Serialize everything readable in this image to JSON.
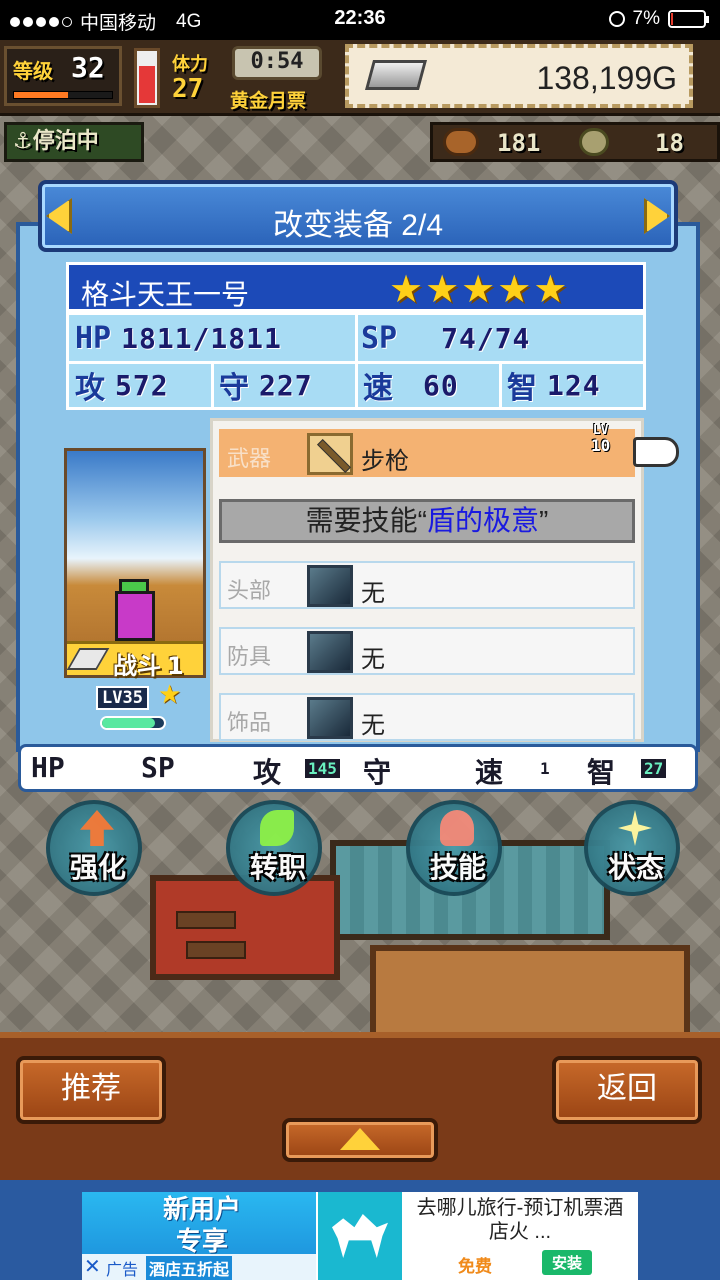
{
  "status_bar": {
    "carrier": "中国移动",
    "network": "4G",
    "time": "22:36",
    "battery": "7%",
    "battery_level": 0.07,
    "signal_dots_filled": 4,
    "signal_dots_total": 5
  },
  "hud": {
    "level_label": "等级",
    "level_value": "32",
    "level_progress": 0.55,
    "stamina_label": "体力",
    "stamina_value": "27",
    "stamina_level": 0.75,
    "timer": "0:54",
    "ticket_label": "黄金月票",
    "gold_value": "138,199G",
    "docked_label": "停泊中",
    "resource_1": "181",
    "resource_2": "18"
  },
  "dialog": {
    "title": "改变装备 2/4",
    "character_name": "格斗天王一号",
    "star_count": 5,
    "stats": {
      "hp_label": "HP",
      "hp_value": "1811/1811",
      "sp_label": "SP",
      "sp_value": "74/74",
      "atk_label": "攻",
      "atk_value": "572",
      "def_label": "守",
      "def_value": "227",
      "spd_label": "速",
      "spd_value": "60",
      "int_label": "智",
      "int_value": "124"
    },
    "portrait": {
      "class_label": "战斗",
      "class_rank": "1",
      "level_text": "LV35",
      "exp_progress": 0.85
    },
    "equipment": {
      "weapon": {
        "slot": "武器",
        "name": "步枪",
        "lv_label": "LV",
        "lv_value": "10"
      },
      "skill_prefix": "需要技能“",
      "skill_name": "盾的极意",
      "skill_suffix": "”",
      "head": {
        "slot": "头部",
        "name": "无"
      },
      "armor": {
        "slot": "防具",
        "name": "无"
      },
      "accessory": {
        "slot": "饰品",
        "name": "无"
      }
    },
    "bonus_stats": {
      "hp_label": "HP",
      "sp_label": "SP",
      "atk_label": "攻",
      "atk_value": "145",
      "def_label": "守",
      "spd_label": "速",
      "spd_value": "1",
      "int_label": "智",
      "int_value": "27"
    }
  },
  "actions": {
    "upgrade": "强化",
    "change_job": "转职",
    "skills": "技能",
    "status": "状态"
  },
  "footer": {
    "recommend": "推荐",
    "back": "返回"
  },
  "ad": {
    "promo_line1": "新用户",
    "promo_line2": "专享",
    "ad_tag": "广告",
    "promo_sub": "酒店五折起",
    "title": "去哪儿旅行-预订机票酒店火 ...",
    "free": "免费",
    "install": "安装"
  },
  "colors": {
    "dialog_blue": "#8fc6ea",
    "title_blue": "#2a62b8",
    "weapon_row": "#f4b272",
    "skill_name_color": "#1a1ae0",
    "star_gold": "#ffd018"
  }
}
